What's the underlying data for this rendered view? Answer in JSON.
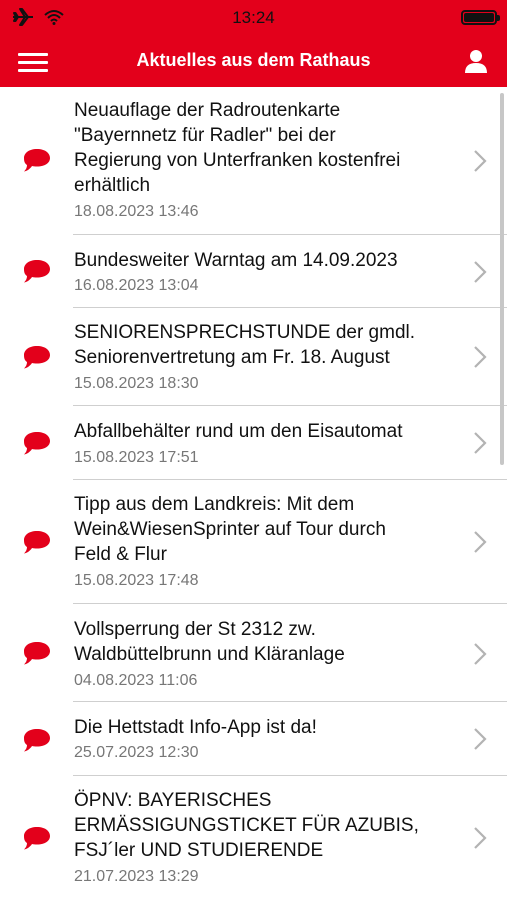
{
  "status_bar": {
    "time": "13:24",
    "icons": [
      "airplane-icon",
      "wifi-icon",
      "battery-icon"
    ]
  },
  "nav": {
    "title": "Aktuelles aus dem Rathaus",
    "menu_icon": "hamburger-menu-icon",
    "profile_icon": "user-icon"
  },
  "colors": {
    "accent": "#e3001b",
    "date_text": "#777777",
    "separator": "#cfcfcf"
  },
  "items": [
    {
      "title_lines": [
        "Neuauflage der Radroutenkarte",
        "\"Bayernnetz für Radler\" bei der",
        "Regierung von Unterfranken kostenfrei",
        "erhältlich"
      ],
      "date": "18.08.2023 13:46"
    },
    {
      "title_lines": [
        "Bundesweiter Warntag am 14.09.2023"
      ],
      "date": "16.08.2023 13:04"
    },
    {
      "title_lines": [
        "SENIORENSPRECHSTUNDE der gmdl.",
        "Seniorenvertretung am Fr. 18. August"
      ],
      "date": "15.08.2023 18:30"
    },
    {
      "title_lines": [
        "Abfallbehälter rund um den Eisautomat"
      ],
      "date": "15.08.2023 17:51"
    },
    {
      "title_lines": [
        "Tipp aus dem Landkreis: Mit dem",
        "Wein&WiesenSprinter auf Tour durch",
        "Feld & Flur"
      ],
      "date": "15.08.2023 17:48"
    },
    {
      "title_lines": [
        "Vollsperrung der St 2312 zw.",
        "Waldbüttelbrunn und Kläranlage"
      ],
      "date": "04.08.2023 11:06"
    },
    {
      "title_lines": [
        "Die Hettstadt Info-App ist da!"
      ],
      "date": "25.07.2023 12:30"
    },
    {
      "title_lines": [
        "ÖPNV: BAYERISCHES",
        "ERMÄSSIGUNGSTICKET FÜR AZUBIS,",
        "FSJ´ler UND STUDIERENDE"
      ],
      "date": "21.07.2023 13:29"
    }
  ]
}
